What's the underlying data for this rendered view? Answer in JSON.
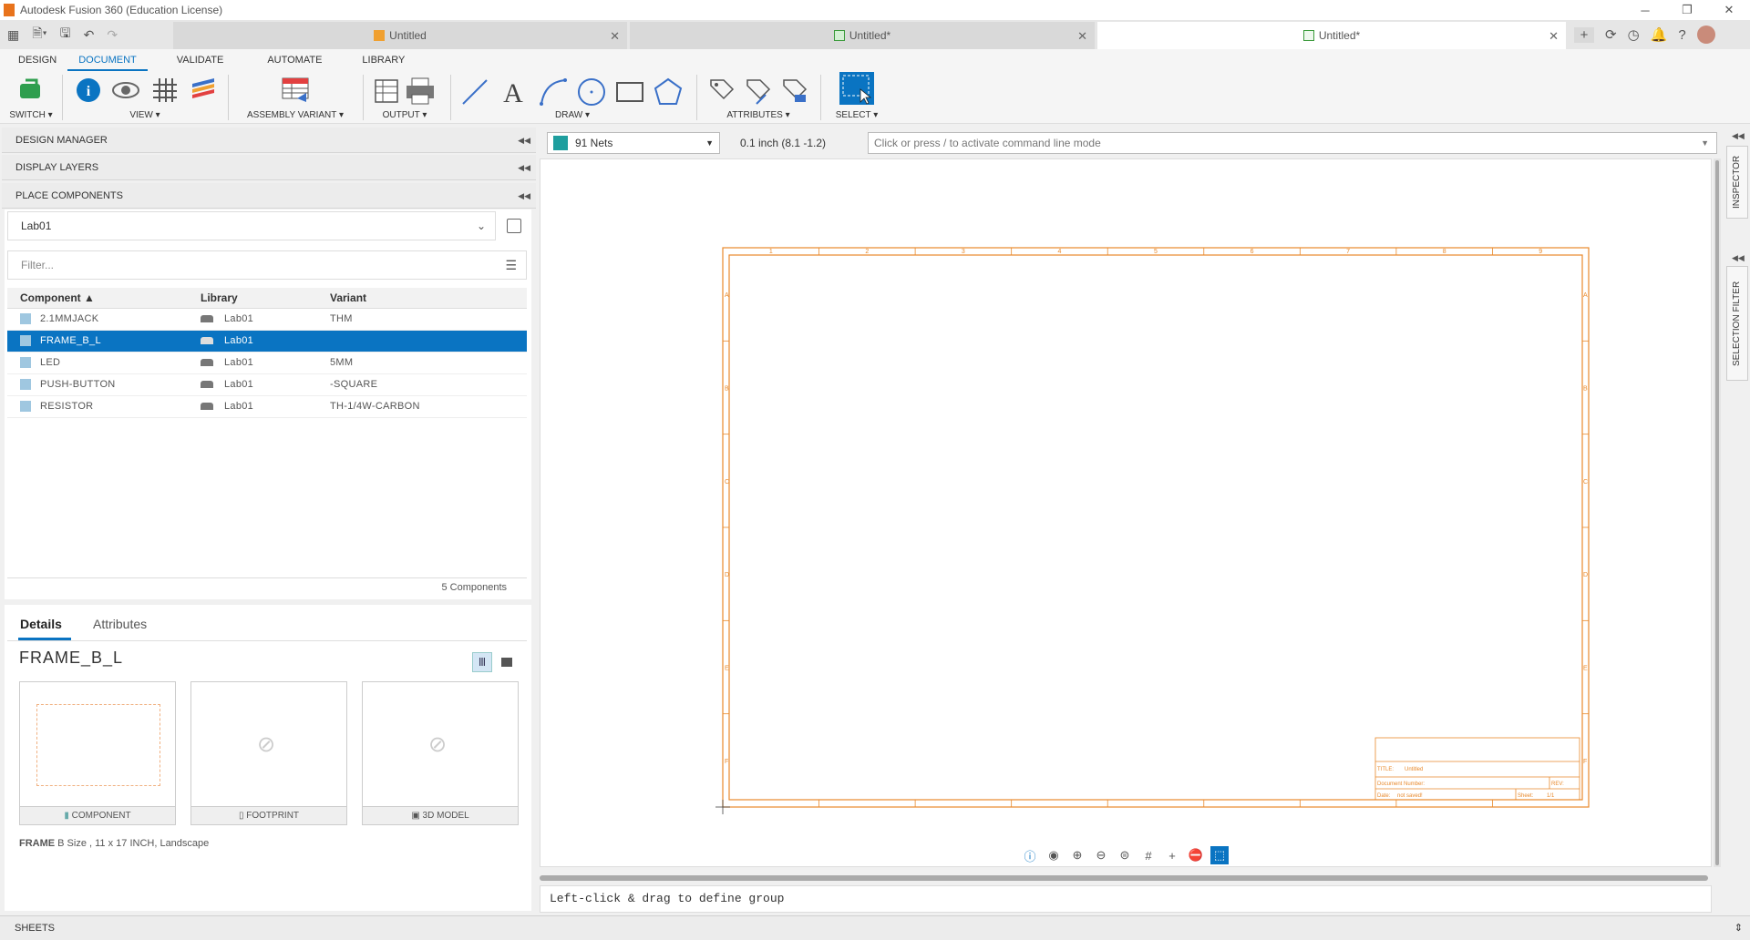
{
  "window": {
    "title": "Autodesk Fusion 360 (Education License)"
  },
  "doc_tabs": [
    {
      "label": "Untitled"
    },
    {
      "label": "Untitled*"
    },
    {
      "label": "Untitled*"
    }
  ],
  "ribbon": {
    "tabs": [
      "DESIGN",
      "DOCUMENT",
      "VALIDATE",
      "AUTOMATE",
      "LIBRARY"
    ],
    "active_tab": "DOCUMENT",
    "groups": {
      "switch": "SWITCH ▾",
      "view": "VIEW ▾",
      "assembly_variant": "ASSEMBLY VARIANT ▾",
      "output": "OUTPUT ▾",
      "draw": "DRAW ▾",
      "attributes": "ATTRIBUTES ▾",
      "select": "SELECT ▾"
    }
  },
  "left_panel": {
    "design_manager": "DESIGN MANAGER",
    "display_layers": "DISPLAY LAYERS",
    "place_components": "PLACE COMPONENTS",
    "library_select": "Lab01",
    "filter_placeholder": "Filter...",
    "columns": [
      "Component",
      "Library",
      "Variant"
    ],
    "rows": [
      {
        "component": "2.1MMJACK",
        "library": "Lab01",
        "variant": "THM"
      },
      {
        "component": "FRAME_B_L",
        "library": "Lab01",
        "variant": ""
      },
      {
        "component": "LED",
        "library": "Lab01",
        "variant": "5MM"
      },
      {
        "component": "PUSH-BUTTON",
        "library": "Lab01",
        "variant": "-SQUARE"
      },
      {
        "component": "RESISTOR",
        "library": "Lab01",
        "variant": "TH-1/4W-CARBON"
      }
    ],
    "count": "5 Components",
    "details_tab": "Details",
    "attributes_tab": "Attributes",
    "selected_name": "FRAME_B_L",
    "preview_captions": [
      "COMPONENT",
      "FOOTPRINT",
      "3D MODEL"
    ],
    "description_bold": "FRAME",
    "description_rest": " B Size , 11 x 17 INCH, Landscape"
  },
  "canvas": {
    "net_select": "91 Nets",
    "grid_readout": "0.1 inch (8.1 -1.2)",
    "command_placeholder": "Click or press / to activate command line mode",
    "status_message": "Left-click & drag to define group",
    "frame_cols": [
      "1",
      "2",
      "3",
      "4",
      "5",
      "6",
      "7",
      "8",
      "9"
    ],
    "frame_rows": [
      "A",
      "B",
      "C",
      "D",
      "E",
      "F"
    ],
    "title_block": {
      "title_label": "TITLE:",
      "title_value": "Untitled",
      "doc_number": "Document Number:",
      "rev": "REV:",
      "date_label": "Date:",
      "date_value": "not saved!",
      "sheet_label": "Sheet:",
      "sheet_value": "1/1"
    }
  },
  "right_dock": {
    "inspector": "INSPECTOR",
    "selection_filter": "SELECTION FILTER"
  },
  "sheets_bar": "SHEETS",
  "colors": {
    "accent": "#0a74c2",
    "frame": "#e8892b",
    "net_swatch": "#1e9e9e"
  }
}
